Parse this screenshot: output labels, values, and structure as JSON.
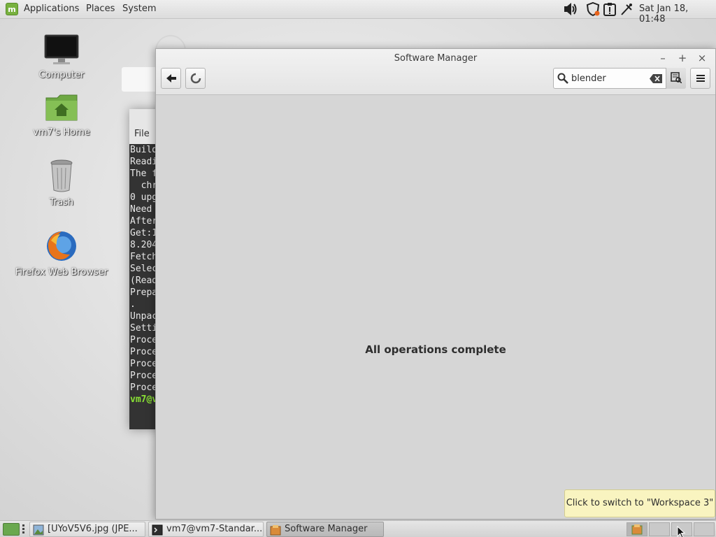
{
  "top_panel": {
    "menus": [
      "Applications",
      "Places",
      "System"
    ],
    "clock": "Sat Jan 18, 01:48",
    "tray_icons": [
      "volume-icon",
      "shield-update-icon",
      "alert-clipboard-icon",
      "network-icon"
    ]
  },
  "desktop": {
    "icons": [
      {
        "label": "Computer",
        "icon": "monitor-icon"
      },
      {
        "label": "vm7's Home",
        "icon": "home-folder-icon"
      },
      {
        "label": "Trash",
        "icon": "trash-icon"
      },
      {
        "label": "Firefox Web Browser",
        "icon": "firefox-icon"
      }
    ]
  },
  "terminal": {
    "menu_file": "File",
    "lines": [
      "Build",
      "Readi",
      "The f",
      "  chr",
      "0 upg",
      "Need ",
      "After",
      "Get:1",
      "8.204",
      "Fetch",
      "Selec",
      "(Read",
      "Prepa",
      ".",
      "Unpac",
      "Setti",
      "Proce",
      "Proce",
      "Proce",
      "Proce",
      "Proce"
    ],
    "prompt": "vm7@v"
  },
  "software_manager": {
    "title": "Software Manager",
    "controls": {
      "minimize": "–",
      "maximize": "+",
      "close": "×"
    },
    "search": {
      "value": "blender",
      "placeholder": ""
    },
    "status": "All operations complete"
  },
  "tooltip": "Click to switch to \"Workspace 3\"",
  "taskbar": {
    "tasks": [
      {
        "label": "[UYoV5V6.jpg (JPE...",
        "icon": "image-viewer-icon"
      },
      {
        "label": "vm7@vm7-Standar...",
        "icon": "terminal-icon"
      },
      {
        "label": "Software Manager",
        "icon": "software-manager-icon",
        "active": true
      }
    ],
    "workspaces": 4
  },
  "colors": {
    "mint_green": "#78b13f",
    "prompt_green": "#8ae234",
    "tooltip_bg": "#f9f4c0"
  }
}
